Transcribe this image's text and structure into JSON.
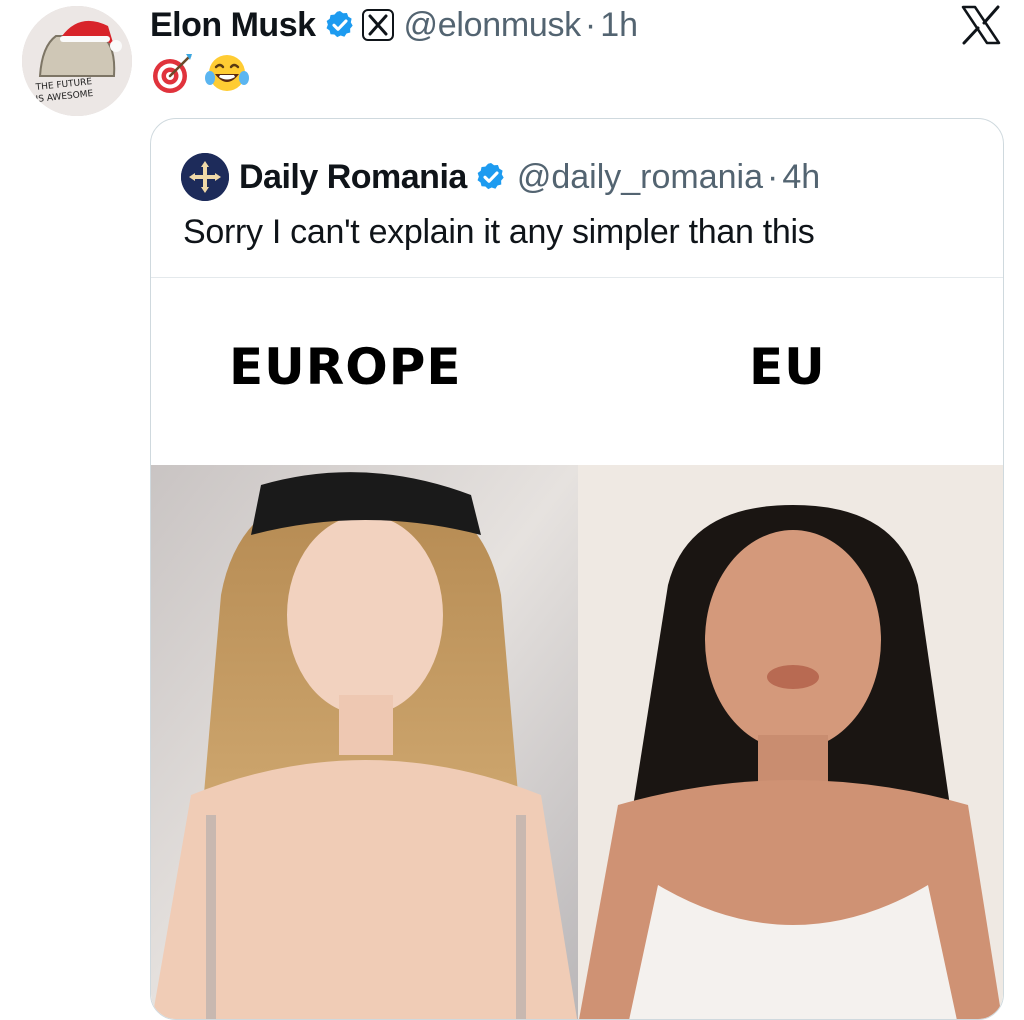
{
  "post": {
    "author_name": "Elon Musk",
    "handle": "@elonmusk",
    "separator": "·",
    "time": "1h",
    "emojis": [
      "direct-hit-emoji",
      "tears-of-joy-emoji"
    ]
  },
  "quote": {
    "author_name": "Daily Romania",
    "handle": "@daily_romania",
    "separator": "·",
    "time": "4h",
    "text": "Sorry I can't explain it any simpler than this",
    "meme": {
      "left_label": "EUROPE",
      "right_label": "EU"
    }
  },
  "colors": {
    "verified_blue": "#1d9bf0",
    "secondary_text": "#536471",
    "border": "#cfd9de"
  }
}
